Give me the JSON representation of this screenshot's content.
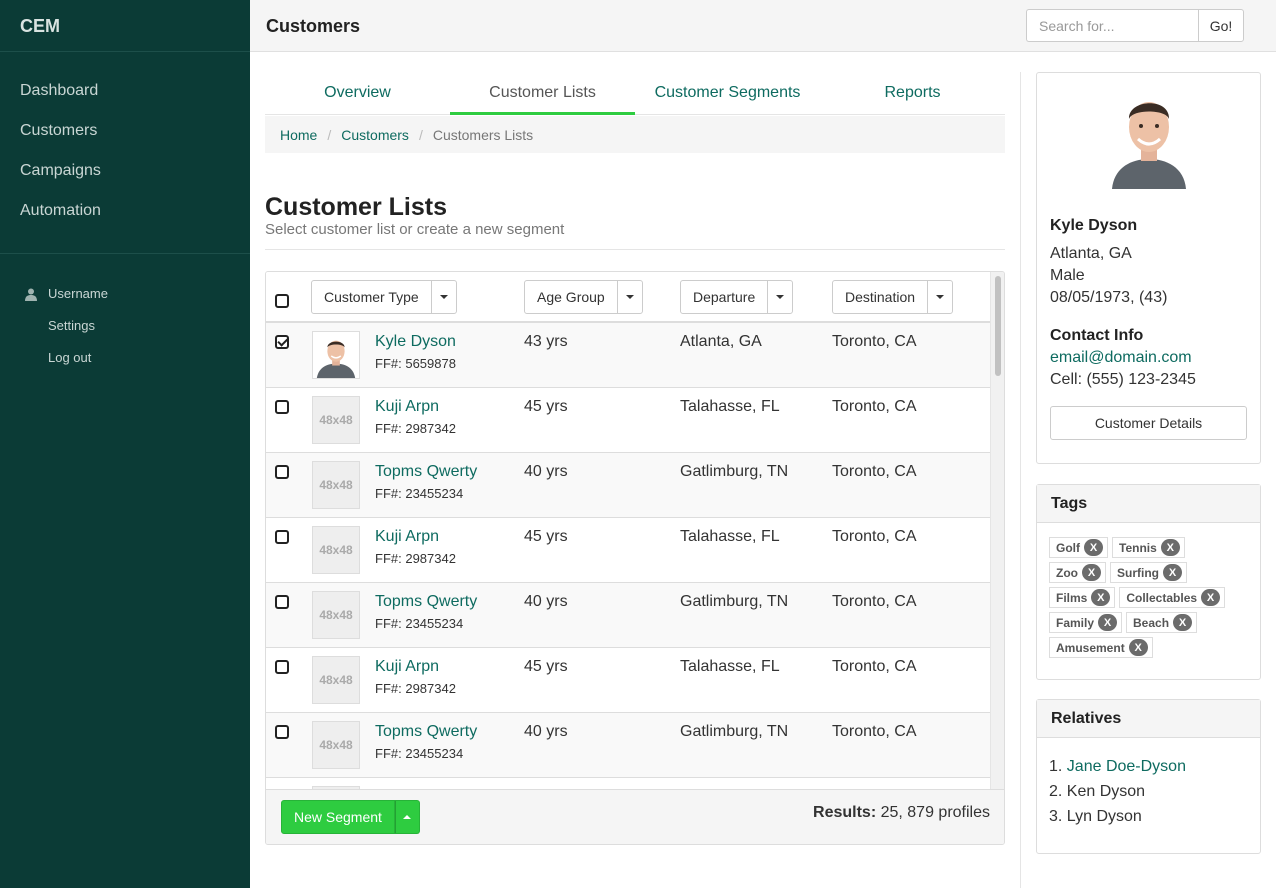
{
  "app": {
    "brand": "CEM",
    "page_title": "Customers"
  },
  "sidebar": {
    "nav": [
      {
        "label": "Dashboard"
      },
      {
        "label": "Customers"
      },
      {
        "label": "Campaigns"
      },
      {
        "label": "Automation"
      }
    ],
    "user": {
      "name": "Username",
      "settings": "Settings",
      "logout": "Log out"
    }
  },
  "search": {
    "placeholder": "Search for...",
    "button": "Go!"
  },
  "tabs": [
    {
      "label": "Overview"
    },
    {
      "label": "Customer Lists"
    },
    {
      "label": "Customer Segments"
    },
    {
      "label": "Reports"
    }
  ],
  "breadcrumb": {
    "home": "Home",
    "customers": "Customers",
    "current": "Customers Lists"
  },
  "list": {
    "title": "Customer Lists",
    "subtitle": "Select customer list or create a new segment",
    "filters": {
      "customer_type": "Customer Type",
      "age_group": "Age Group",
      "departure": "Departure",
      "destination": "Destination"
    },
    "rows": [
      {
        "name": "Kyle Dyson",
        "ff": "FF#: 5659878",
        "age": "43 yrs",
        "departure": "Atlanta, GA",
        "destination": "Toronto, CA",
        "avatar": ""
      },
      {
        "name": "Kuji Arpn",
        "ff": "FF#: 2987342",
        "age": "45 yrs",
        "departure": "Talahasse, FL",
        "destination": "Toronto, CA",
        "avatar": "48x48"
      },
      {
        "name": "Topms Qwerty",
        "ff": "FF#: 23455234",
        "age": "40 yrs",
        "departure": "Gatlimburg, TN",
        "destination": "Toronto, CA",
        "avatar": "48x48"
      },
      {
        "name": "Kuji Arpn",
        "ff": "FF#: 2987342",
        "age": "45 yrs",
        "departure": "Talahasse, FL",
        "destination": "Toronto, CA",
        "avatar": "48x48"
      },
      {
        "name": "Topms Qwerty",
        "ff": "FF#: 23455234",
        "age": "40 yrs",
        "departure": "Gatlimburg, TN",
        "destination": "Toronto, CA",
        "avatar": "48x48"
      },
      {
        "name": "Kuji Arpn",
        "ff": "FF#: 2987342",
        "age": "45 yrs",
        "departure": "Talahasse, FL",
        "destination": "Toronto, CA",
        "avatar": "48x48"
      },
      {
        "name": "Topms Qwerty",
        "ff": "FF#: 23455234",
        "age": "40 yrs",
        "departure": "Gatlimburg, TN",
        "destination": "Toronto, CA",
        "avatar": "48x48"
      }
    ],
    "new_segment": "New Segment",
    "results_label": "Results:",
    "results_value": "25, 879 profiles"
  },
  "profile": {
    "name": "Kyle Dyson",
    "location": "Atlanta, GA",
    "gender": "Male",
    "dob": "08/05/1973, (43)",
    "contact_heading": "Contact Info",
    "email": "email@domain.com",
    "cell": "Cell: (555) 123-2345",
    "details_button": "Customer Details"
  },
  "tags": {
    "heading": "Tags",
    "rows": [
      [
        "Golf",
        "Tennis"
      ],
      [
        "Zoo",
        "Surfing"
      ],
      [
        "Films",
        "Collectables"
      ],
      [
        "Family",
        "Beach"
      ],
      [
        "Amusement"
      ]
    ],
    "remove_label": "X"
  },
  "relatives": {
    "heading": "Relatives",
    "items": [
      "1.",
      "Jane Doe-Dyson",
      "2. Ken Dyson",
      "3. Lyn Dyson"
    ]
  },
  "colors": {
    "sidebar": "#0b3b36",
    "link": "#0e6b60",
    "accent": "#2ecc40"
  }
}
